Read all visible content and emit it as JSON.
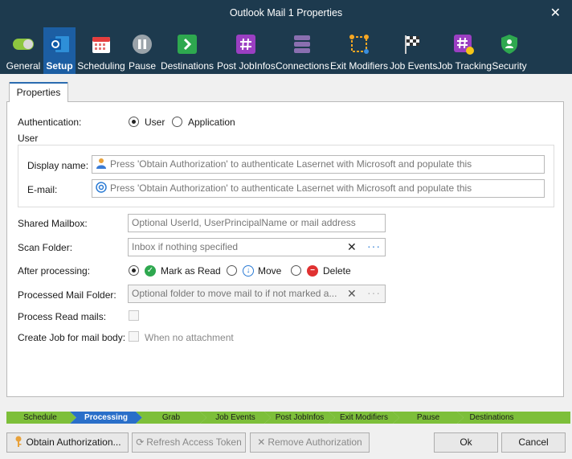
{
  "window": {
    "title": "Outlook Mail 1 Properties"
  },
  "toolbar": {
    "items": [
      {
        "label": "General"
      },
      {
        "label": "Setup"
      },
      {
        "label": "Scheduling"
      },
      {
        "label": "Pause"
      },
      {
        "label": "Destinations"
      },
      {
        "label": "Post JobInfos"
      },
      {
        "label": "Connections"
      },
      {
        "label": "Exit Modifiers"
      },
      {
        "label": "Job Events"
      },
      {
        "label": "Job Tracking"
      },
      {
        "label": "Security"
      }
    ],
    "active": "Setup"
  },
  "tabs": {
    "properties": "Properties"
  },
  "form": {
    "authentication_label": "Authentication:",
    "auth_options": [
      "User",
      "Application"
    ],
    "auth_selected": "User",
    "user_group_label": "User",
    "display_name_label": "Display name:",
    "display_name_placeholder": "Press 'Obtain Authorization' to authenticate Lasernet with Microsoft and populate this",
    "email_label": "E-mail:",
    "email_placeholder": "Press 'Obtain Authorization' to authenticate Lasernet with Microsoft and populate this",
    "shared_mailbox_label": "Shared Mailbox:",
    "shared_mailbox_placeholder": "Optional UserId, UserPrincipalName or mail address",
    "scan_folder_label": "Scan Folder:",
    "scan_folder_placeholder": "Inbox if nothing specified",
    "after_processing_label": "After processing:",
    "after_options": [
      "Mark as Read",
      "Move",
      "Delete"
    ],
    "after_selected": "Mark as Read",
    "processed_folder_label": "Processed Mail Folder:",
    "processed_folder_placeholder": "Optional folder to move mail to if not marked a...",
    "process_read_label": "Process Read mails:",
    "create_job_label": "Create Job for mail body:",
    "when_no_attachment_label": "When no attachment"
  },
  "workflow": {
    "steps": [
      "Schedule",
      "Processing",
      "Grab",
      "Job Events",
      "Post JobInfos",
      "Exit Modifiers",
      "Pause",
      "Destinations"
    ],
    "active": "Processing"
  },
  "buttons": {
    "obtain_auth": "Obtain Authorization...",
    "refresh_token": "Refresh Access Token",
    "remove_auth": "Remove Authorization",
    "ok": "Ok",
    "cancel": "Cancel"
  },
  "colors": {
    "titlebar": "#1d3a4e",
    "active_tab": "#1c5ea3",
    "workflow_green": "#7dbf3a",
    "workflow_active": "#2a6fc9"
  }
}
